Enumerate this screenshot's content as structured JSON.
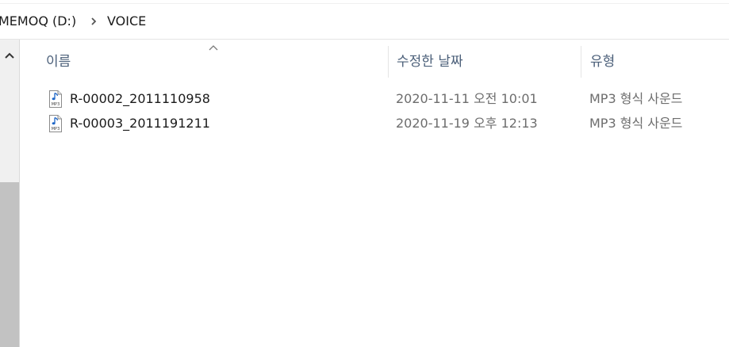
{
  "breadcrumb": {
    "items": [
      "MEMOQ (D:)",
      "VOICE"
    ]
  },
  "columns": {
    "name": "이름",
    "date_modified": "수정한 날짜",
    "type": "유형"
  },
  "sort": {
    "column": "name",
    "direction": "ascending"
  },
  "files": [
    {
      "name": "R-00002_2011110958",
      "date_modified": "2020-11-11 오전 10:01",
      "type": "MP3 형식 사운드",
      "icon": "mp3-file-icon"
    },
    {
      "name": "R-00003_2011191211",
      "date_modified": "2020-11-19 오후 12:13",
      "type": "MP3 형식 사운드",
      "icon": "mp3-file-icon"
    }
  ],
  "colors": {
    "header_text": "#4c607a",
    "secondary_text": "#6d6d6d",
    "primary_text": "#1a1a1a",
    "scrollbar_thumb": "#c2c2c2"
  }
}
